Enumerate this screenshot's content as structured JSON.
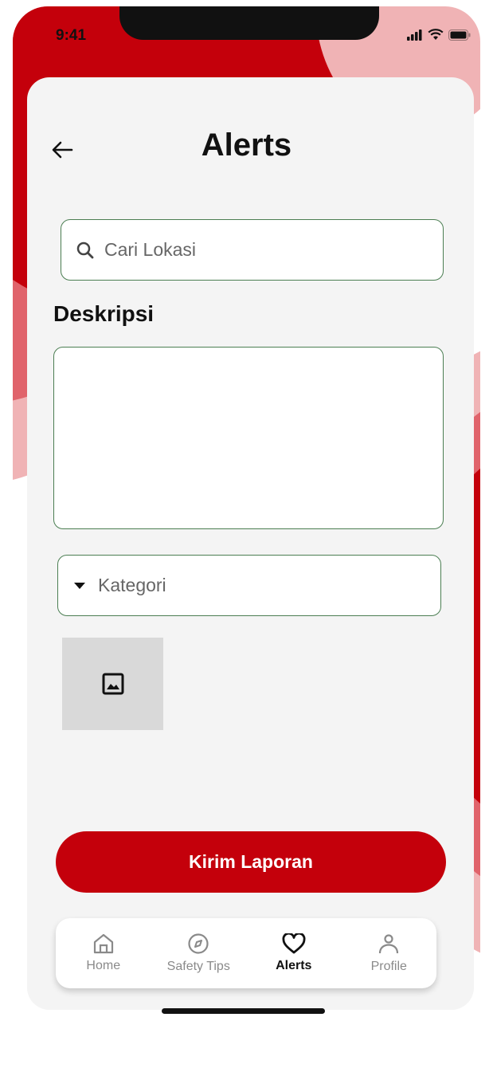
{
  "status_bar": {
    "time": "9:41"
  },
  "header": {
    "title": "Alerts"
  },
  "search": {
    "placeholder": "Cari Lokasi"
  },
  "description": {
    "label": "Deskripsi",
    "value": ""
  },
  "category": {
    "placeholder": "Kategori"
  },
  "image_upload": {
    "icon": "image-icon"
  },
  "submit": {
    "label": "Kirim Laporan"
  },
  "bottom_nav": {
    "items": [
      {
        "label": "Home",
        "icon": "home-icon",
        "active": false
      },
      {
        "label": "Safety Tips",
        "icon": "compass-icon",
        "active": false
      },
      {
        "label": "Alerts",
        "icon": "heart-icon",
        "active": true
      },
      {
        "label": "Profile",
        "icon": "profile-icon",
        "active": false
      }
    ]
  },
  "colors": {
    "primary": "#c4000b",
    "field_border": "#4b7e52",
    "card_bg": "#f4f4f4",
    "blob_light": "#f0b3b5",
    "blob_mid": "#e0636b"
  }
}
